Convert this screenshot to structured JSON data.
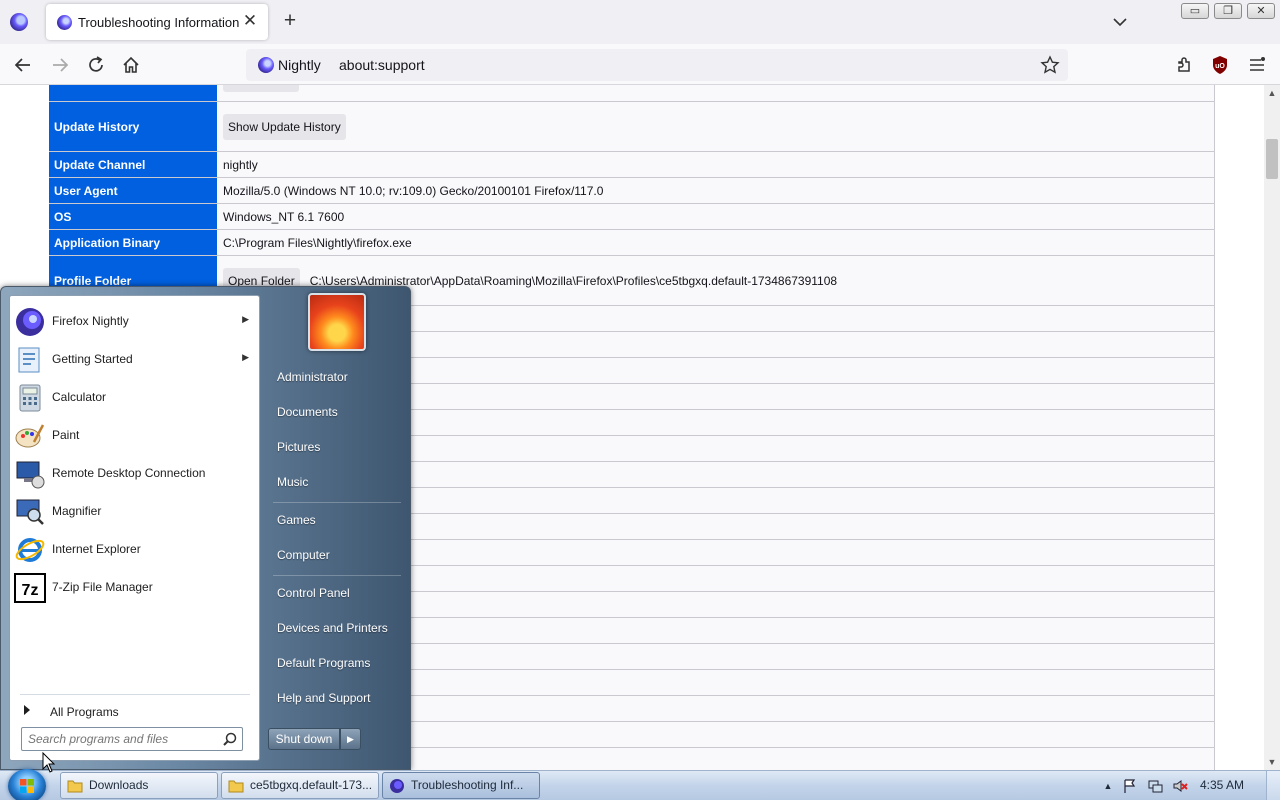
{
  "browser": {
    "tab_title": "Troubleshooting Information",
    "identity_label": "Nightly",
    "url": "about:support"
  },
  "support_table": {
    "rows": [
      {
        "label": "",
        "value": "",
        "button": ""
      },
      {
        "label": "Update History",
        "value": "",
        "button": "Show Update History"
      },
      {
        "label": "Update Channel",
        "value": "nightly",
        "button": ""
      },
      {
        "label": "User Agent",
        "value": "Mozilla/5.0 (Windows NT 10.0; rv:109.0) Gecko/20100101 Firefox/117.0",
        "button": ""
      },
      {
        "label": "OS",
        "value": "Windows_NT 6.1 7600",
        "button": ""
      },
      {
        "label": "Application Binary",
        "value": "C:\\Program Files\\Nightly\\firefox.exe",
        "button": ""
      },
      {
        "label": "Profile Folder",
        "value": "C:\\Users\\Administrator\\AppData\\Roaming\\Mozilla\\Firefox\\Profiles\\ce5tbgxq.default-1734867391108",
        "button": "Open Folder"
      }
    ]
  },
  "start_menu": {
    "programs": [
      {
        "label": "Firefox Nightly",
        "icon": "firefox-nightly-icon",
        "has_submenu": true
      },
      {
        "label": "Getting Started",
        "icon": "getting-started-icon",
        "has_submenu": true
      },
      {
        "label": "Calculator",
        "icon": "calculator-icon",
        "has_submenu": false
      },
      {
        "label": "Paint",
        "icon": "paint-icon",
        "has_submenu": false
      },
      {
        "label": "Remote Desktop Connection",
        "icon": "remote-desktop-icon",
        "has_submenu": false
      },
      {
        "label": "Magnifier",
        "icon": "magnifier-icon",
        "has_submenu": false
      },
      {
        "label": "Internet Explorer",
        "icon": "internet-explorer-icon",
        "has_submenu": false
      },
      {
        "label": "7-Zip File Manager",
        "icon": "7zip-icon",
        "has_submenu": false
      }
    ],
    "all_programs": "All Programs",
    "search_placeholder": "Search programs and files",
    "right_items": [
      "Administrator",
      "Documents",
      "Pictures",
      "Music",
      "Games",
      "Computer",
      "Control Panel",
      "Devices and Printers",
      "Default Programs",
      "Help and Support"
    ],
    "shutdown_label": "Shut down"
  },
  "taskbar": {
    "tasks": [
      {
        "label": "Downloads",
        "icon": "folder-icon"
      },
      {
        "label": "ce5tbgxq.default-173...",
        "icon": "folder-icon"
      },
      {
        "label": "Troubleshooting Inf...",
        "icon": "firefox-nightly-icon"
      }
    ],
    "clock": "4:35 AM"
  },
  "colors": {
    "table_header_bg": "#0060df",
    "start_menu_panel": "#6d8aa6"
  }
}
